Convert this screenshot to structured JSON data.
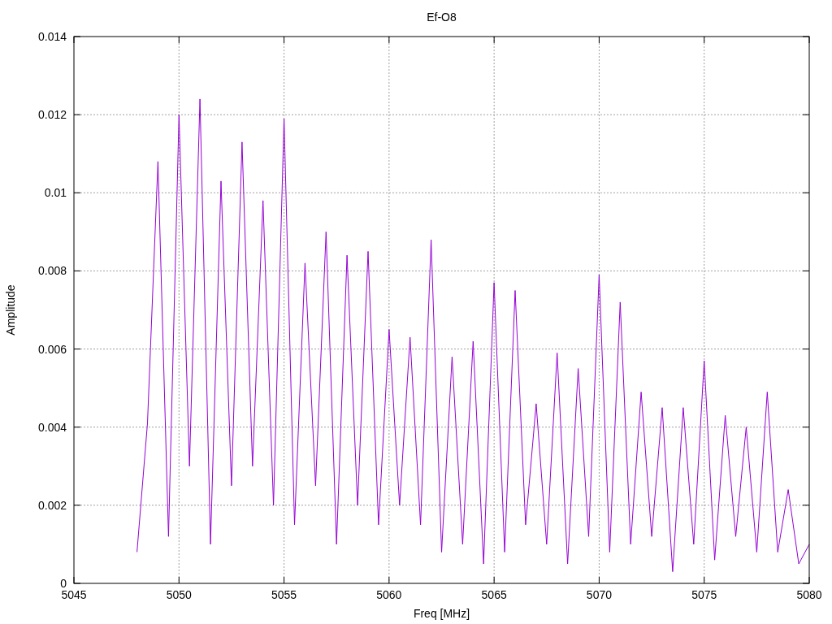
{
  "chart_data": {
    "type": "line",
    "title": "Ef-O8",
    "xlabel": "Freq [MHz]",
    "ylabel": "Amplitude",
    "grid": true,
    "xlim": [
      5045,
      5080
    ],
    "ylim": [
      0,
      0.014
    ],
    "xticks": [
      5045,
      5050,
      5055,
      5060,
      5065,
      5070,
      5075,
      5080
    ],
    "yticks": [
      {
        "value": 0,
        "label": "0"
      },
      {
        "value": 0.002,
        "label": "0.002"
      },
      {
        "value": 0.004,
        "label": "0.004"
      },
      {
        "value": 0.006,
        "label": "0.006"
      },
      {
        "value": 0.008,
        "label": "0.008"
      },
      {
        "value": 0.01,
        "label": "0.01"
      },
      {
        "value": 0.012,
        "label": "0.012"
      },
      {
        "value": 0.014,
        "label": "0.014"
      }
    ],
    "x": [
      5048,
      5048.5,
      5049,
      5049.5,
      5050,
      5050.5,
      5051,
      5051.5,
      5052,
      5052.5,
      5053,
      5053.5,
      5054,
      5054.5,
      5055,
      5055.5,
      5056,
      5056.5,
      5057,
      5057.5,
      5058,
      5058.5,
      5059,
      5059.5,
      5060,
      5060.5,
      5061,
      5061.5,
      5062,
      5062.5,
      5063,
      5063.5,
      5064,
      5064.5,
      5065,
      5065.5,
      5066,
      5066.5,
      5067,
      5067.5,
      5068,
      5068.5,
      5069,
      5069.5,
      5070,
      5070.5,
      5071,
      5071.5,
      5072,
      5072.5,
      5073,
      5073.5,
      5074,
      5074.5,
      5075,
      5075.5,
      5076,
      5076.5,
      5077,
      5077.5,
      5078,
      5078.5,
      5079,
      5079.5,
      5080
    ],
    "series": [
      {
        "color": "#9400d3",
        "values": [
          0.0008,
          0.0041,
          0.0108,
          0.0012,
          0.012,
          0.003,
          0.0124,
          0.001,
          0.0103,
          0.0025,
          0.0113,
          0.003,
          0.0098,
          0.002,
          0.0119,
          0.0015,
          0.0082,
          0.0025,
          0.009,
          0.001,
          0.0084,
          0.002,
          0.0085,
          0.0015,
          0.0065,
          0.002,
          0.0063,
          0.0015,
          0.0088,
          0.0008,
          0.0058,
          0.001,
          0.0062,
          0.0005,
          0.0077,
          0.0008,
          0.0075,
          0.0015,
          0.0046,
          0.001,
          0.0059,
          0.0005,
          0.0055,
          0.0012,
          0.0079,
          0.0008,
          0.0072,
          0.001,
          0.0049,
          0.0012,
          0.0045,
          0.0003,
          0.0045,
          0.001,
          0.0057,
          0.0006,
          0.0043,
          0.0012,
          0.004,
          0.0008,
          0.0049,
          0.0008,
          0.0024,
          0.0005,
          0.001
        ]
      }
    ]
  }
}
